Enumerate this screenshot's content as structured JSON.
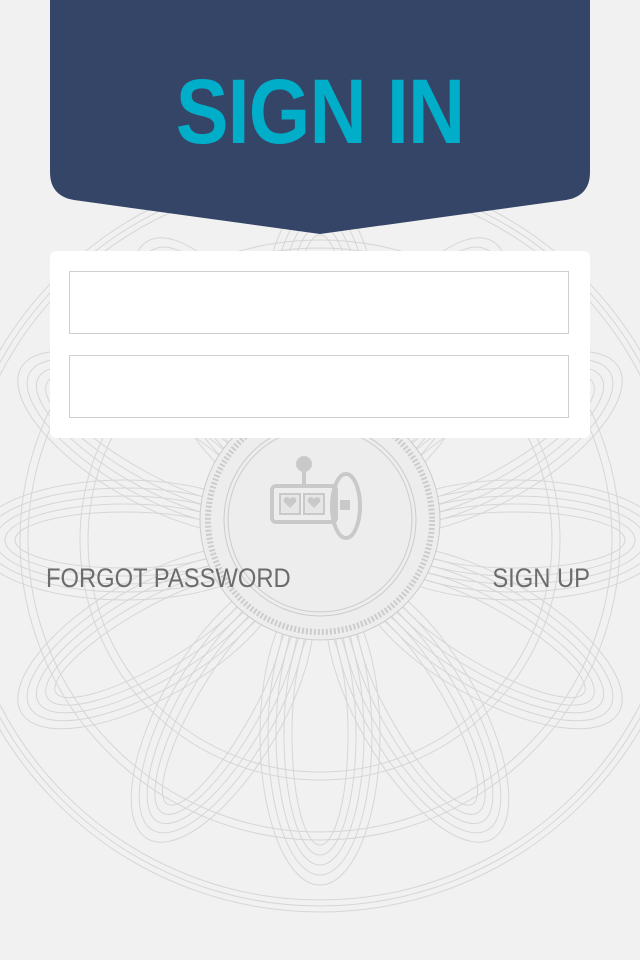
{
  "header": {
    "title": "SIGN IN"
  },
  "form": {
    "username": {
      "value": "",
      "placeholder": ""
    },
    "password": {
      "value": "",
      "placeholder": ""
    }
  },
  "links": {
    "forgot_password": "FORGOT PASSWORD",
    "sign_up": "SIGN UP"
  },
  "icons": {
    "background_emblem": "slot-machine-icon"
  },
  "colors": {
    "banner": "#354568",
    "title": "#00aec9",
    "background": "#f1f1f1",
    "pattern": "#d6d6d6",
    "link_text": "#6c6c6c",
    "card": "#ffffff"
  }
}
